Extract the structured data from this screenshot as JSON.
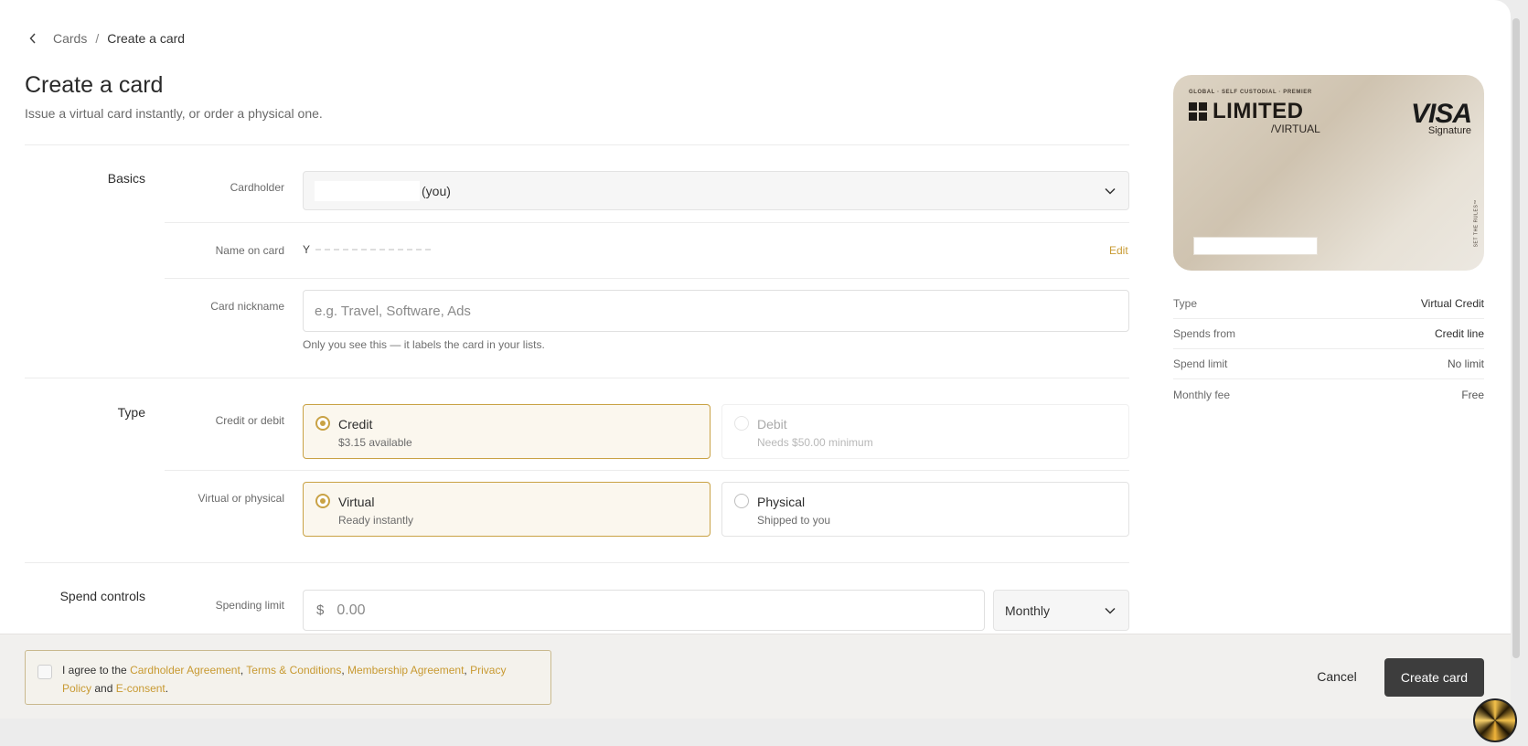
{
  "breadcrumb": {
    "parent": "Cards",
    "separator": "/",
    "current": "Create a card"
  },
  "header": {
    "title": "Create a card",
    "subtitle": "Issue a virtual card instantly, or order a physical one."
  },
  "basics": {
    "section_label": "Basics",
    "cardholder_label": "Cardholder",
    "cardholder_suffix": "(you)",
    "name_label": "Name on card",
    "name_value": "Y",
    "edit_label": "Edit",
    "nickname_label": "Card nickname",
    "nickname_placeholder": "e.g. Travel, Software, Ads",
    "nickname_helper": "Only you see this — it labels the card in your lists."
  },
  "type": {
    "section_label": "Type",
    "credit_debit_label": "Credit or debit",
    "credit": {
      "title": "Credit",
      "subtitle": "$3.15 available",
      "selected": true
    },
    "debit": {
      "title": "Debit",
      "subtitle": "Needs $50.00 minimum",
      "disabled": true
    },
    "virtual_physical_label": "Virtual or physical",
    "virtual": {
      "title": "Virtual",
      "subtitle": "Ready instantly",
      "selected": true
    },
    "physical": {
      "title": "Physical",
      "subtitle": "Shipped to you",
      "selected": false
    }
  },
  "spend_controls": {
    "section_label": "Spend controls",
    "limit_label": "Spending limit",
    "currency_symbol": "$",
    "amount_placeholder": "0.00",
    "period_value": "Monthly"
  },
  "card_preview": {
    "tagline": "GLOBAL · SELF CUSTODIAL · PREMIER",
    "brand": "LIMITED",
    "kind": "/VIRTUAL",
    "network": "VISA",
    "network_tier": "Signature",
    "vertical_text": "SET THE RULES™"
  },
  "summary": [
    {
      "key": "Type",
      "value": "Virtual Credit"
    },
    {
      "key": "Spends from",
      "value": "Credit line"
    },
    {
      "key": "Spend limit",
      "value": "No limit"
    },
    {
      "key": "Monthly fee",
      "value": "Free"
    }
  ],
  "footer": {
    "consent_prefix": "I agree to the",
    "cardholder_agreement": "Cardholder Agreement",
    "comma1": ",",
    "terms": "Terms & Conditions",
    "comma2": ",",
    "membership": "Membership Agreement",
    "comma3": ",",
    "privacy": "Privacy Policy",
    "and": "and",
    "econsent": "E-consent",
    "period": ".",
    "cancel_label": "Cancel",
    "create_label": "Create card"
  },
  "colors": {
    "accent": "#c9a245",
    "link": "#c89a32",
    "primary_button": "#3d3d3d"
  }
}
